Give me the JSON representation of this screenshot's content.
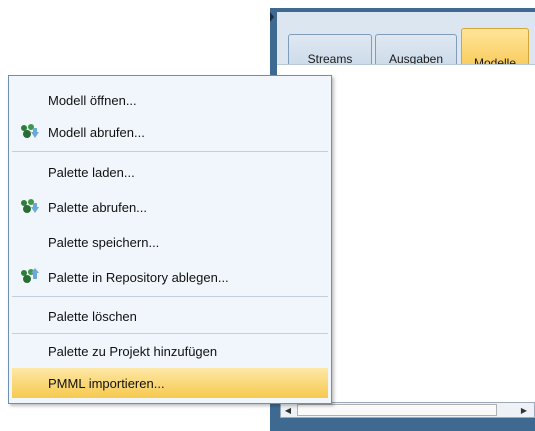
{
  "tabs": [
    {
      "label": "Streams",
      "active": false
    },
    {
      "label": "Ausgaben",
      "active": false
    },
    {
      "label": "Modelle",
      "active": true
    }
  ],
  "menu": {
    "items": [
      {
        "label": "Modell öffnen...",
        "icon": null
      },
      {
        "label": "Modell abrufen...",
        "icon": "repository-retrieve-icon"
      },
      {
        "label": "Palette laden...",
        "icon": null
      },
      {
        "label": "Palette abrufen...",
        "icon": "repository-retrieve-icon"
      },
      {
        "label": "Palette speichern...",
        "icon": null
      },
      {
        "label": "Palette in Repository ablegen...",
        "icon": "repository-store-icon"
      },
      {
        "label": "Palette löschen",
        "icon": null
      },
      {
        "label": "Palette zu Projekt hinzufügen",
        "icon": null
      },
      {
        "label": "PMML importieren...",
        "icon": null,
        "highlighted": true
      }
    ]
  },
  "colors": {
    "highlight": "#f7c94e",
    "active_tab": "#f7c54c",
    "panel_frame": "#3e6a92"
  }
}
